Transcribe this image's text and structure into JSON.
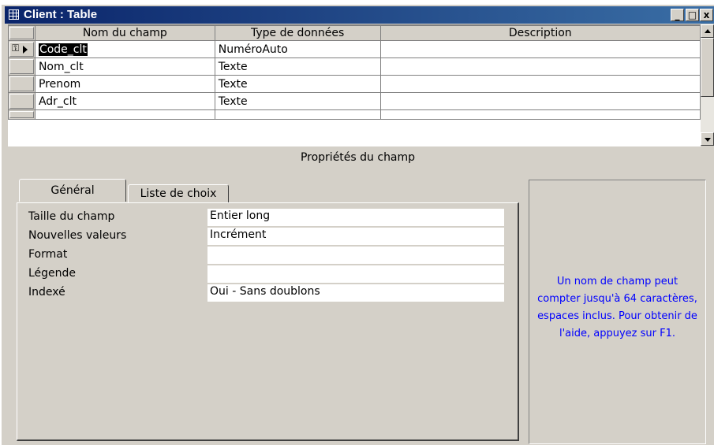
{
  "window": {
    "title": "Client : Table",
    "buttons": {
      "minimize": "_",
      "maximize": "□",
      "close": "x"
    }
  },
  "grid": {
    "columns": [
      "Nom du champ",
      "Type de données",
      "Description"
    ],
    "rows": [
      {
        "name": "Code_clt",
        "type": "NuméroAuto",
        "description": ""
      },
      {
        "name": "Nom_clt",
        "type": "Texte",
        "description": ""
      },
      {
        "name": "Prenom",
        "type": "Texte",
        "description": ""
      },
      {
        "name": "Adr_clt",
        "type": "Texte",
        "description": ""
      },
      {
        "name": "",
        "type": "",
        "description": ""
      }
    ]
  },
  "properties": {
    "section_title": "Propriétés du champ",
    "tabs": [
      "Général",
      "Liste de choix"
    ],
    "fields": [
      {
        "label": "Taille du champ",
        "value": "Entier long"
      },
      {
        "label": "Nouvelles valeurs",
        "value": "Incrément"
      },
      {
        "label": "Format",
        "value": ""
      },
      {
        "label": "Légende",
        "value": ""
      },
      {
        "label": "Indexé",
        "value": "Oui - Sans doublons"
      }
    ],
    "help_text": "Un nom de champ peut compter jusqu'à 64 caractères, espaces inclus. Pour obtenir de l'aide, appuyez sur F1."
  },
  "colors": {
    "titlebar": "#0a246a",
    "face": "#d4d0c8",
    "help_text": "#0000ff"
  },
  "icons": {
    "title": "table-icon",
    "key": "primary-key-icon",
    "row": "current-row-arrow-icon"
  }
}
